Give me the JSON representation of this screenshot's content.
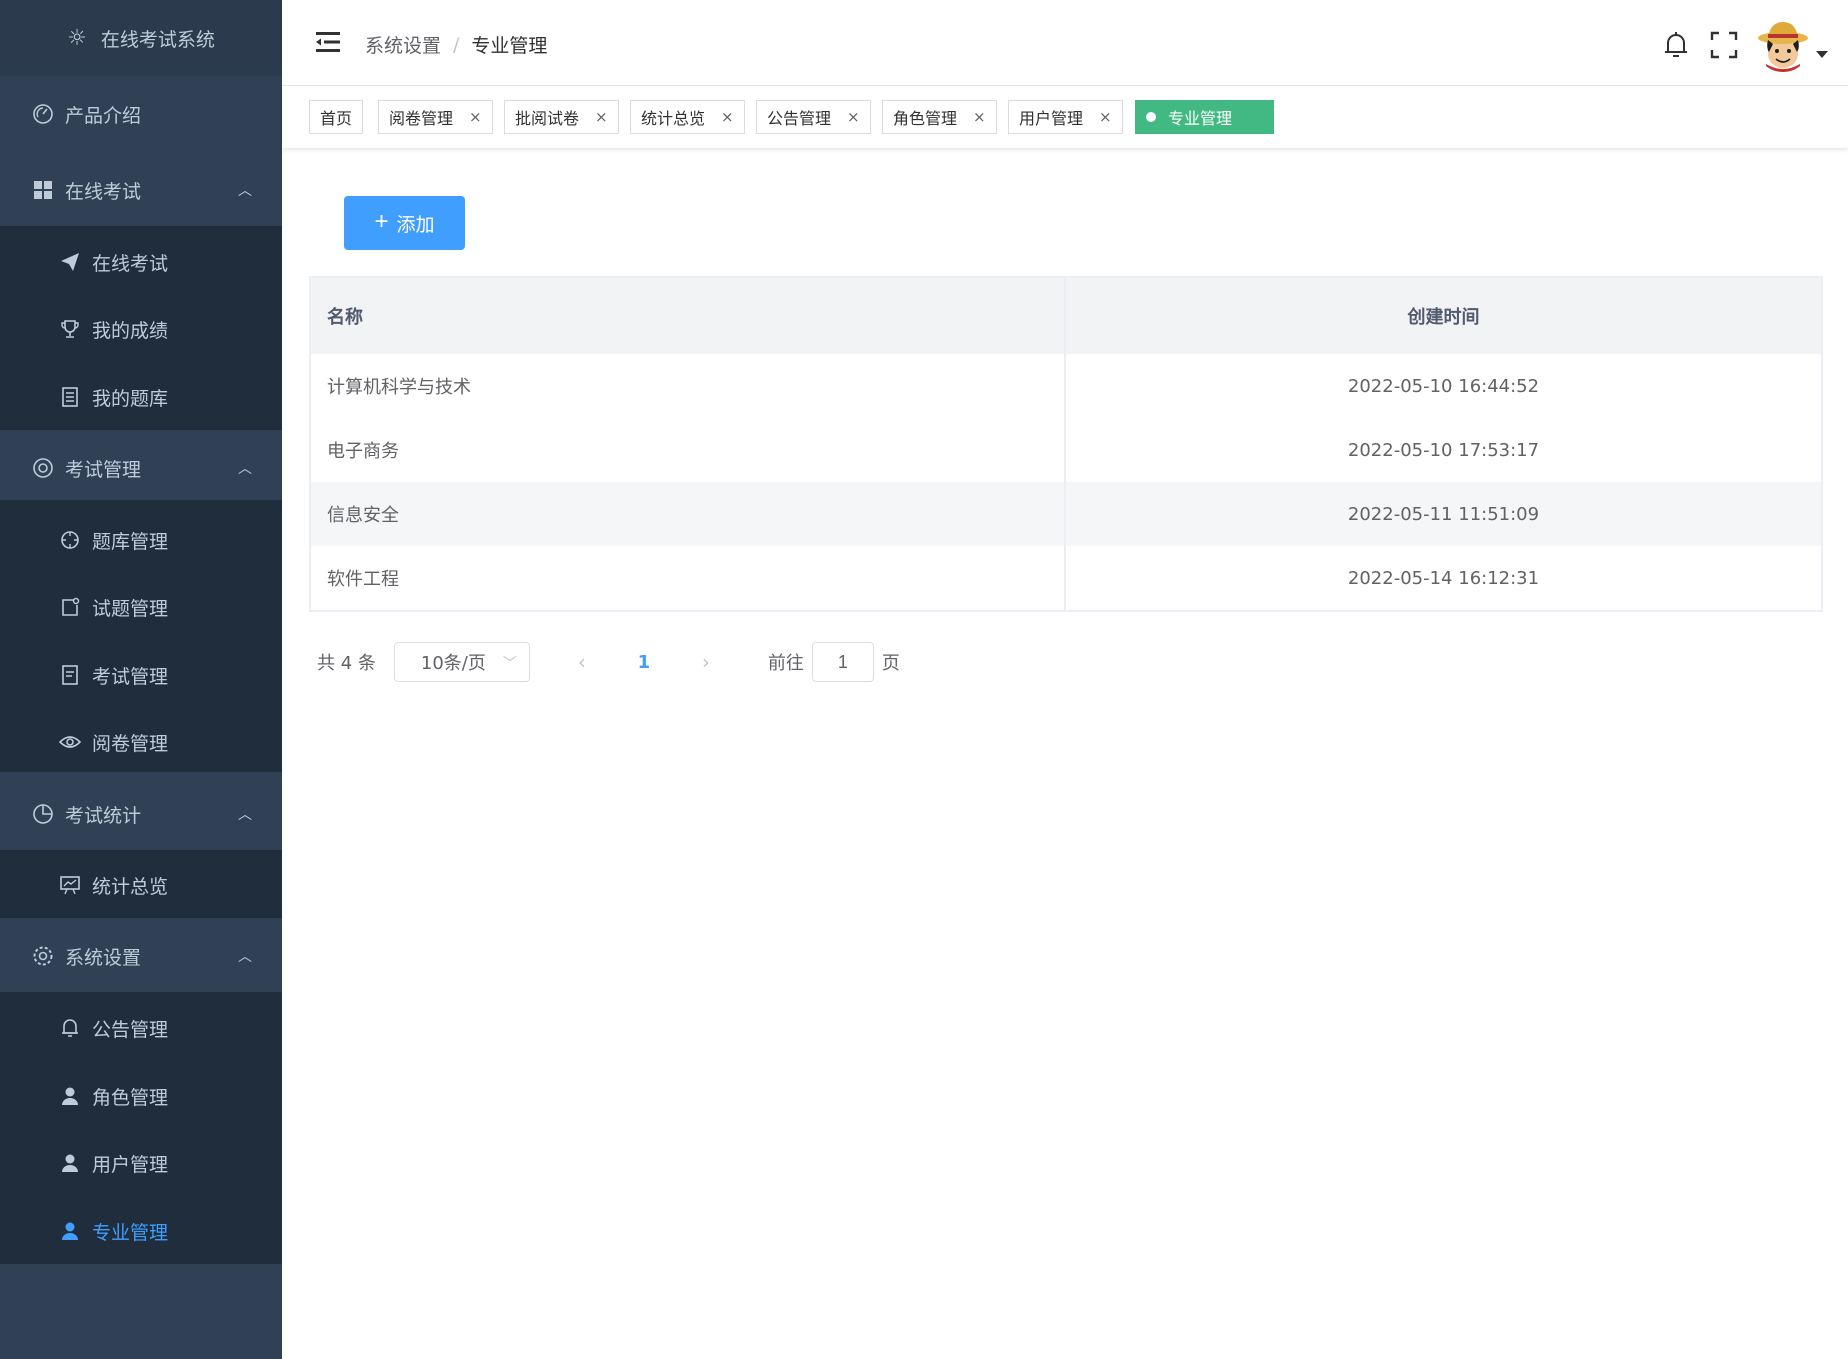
{
  "app": {
    "title": "在线考试系统"
  },
  "sidebar": {
    "items": [
      {
        "label": "产品介绍",
        "icon": "dashboard-icon"
      },
      {
        "label": "在线考试",
        "icon": "grid-icon",
        "expanded": true
      },
      {
        "label": "在线考试",
        "icon": "send-icon"
      },
      {
        "label": "我的成绩",
        "icon": "trophy-icon"
      },
      {
        "label": "我的题库",
        "icon": "book-icon"
      },
      {
        "label": "考试管理",
        "icon": "lifebuoy-icon",
        "expanded": true
      },
      {
        "label": "题库管理",
        "icon": "compass-icon"
      },
      {
        "label": "试题管理",
        "icon": "edit-icon"
      },
      {
        "label": "考试管理",
        "icon": "document-icon"
      },
      {
        "label": "阅卷管理",
        "icon": "eye-icon"
      },
      {
        "label": "考试统计",
        "icon": "pie-chart-icon",
        "expanded": true
      },
      {
        "label": "统计总览",
        "icon": "presentation-icon"
      },
      {
        "label": "系统设置",
        "icon": "gear-icon",
        "expanded": true
      },
      {
        "label": "公告管理",
        "icon": "bell-icon"
      },
      {
        "label": "角色管理",
        "icon": "user-icon"
      },
      {
        "label": "用户管理",
        "icon": "user-icon"
      },
      {
        "label": "专业管理",
        "icon": "user-icon",
        "active": true
      }
    ]
  },
  "breadcrumb": {
    "parent": "系统设置",
    "sep": "/",
    "current": "专业管理"
  },
  "tags": [
    {
      "label": "首页"
    },
    {
      "label": "阅卷管理",
      "close": "×"
    },
    {
      "label": "批阅试卷",
      "close": "×"
    },
    {
      "label": "统计总览",
      "close": "×"
    },
    {
      "label": "公告管理",
      "close": "×"
    },
    {
      "label": "角色管理",
      "close": "×"
    },
    {
      "label": "用户管理",
      "close": "×"
    },
    {
      "label": "专业管理",
      "active": true
    }
  ],
  "toolbar": {
    "add_label": "添加",
    "add_icon": "+"
  },
  "table": {
    "columns": [
      "名称",
      "创建时间"
    ],
    "rows": [
      {
        "name": "计算机科学与技术",
        "created": "2022-05-10 16:44:52"
      },
      {
        "name": "电子商务",
        "created": "2022-05-10 17:53:17"
      },
      {
        "name": "信息安全",
        "created": "2022-05-11 11:51:09"
      },
      {
        "name": "软件工程",
        "created": "2022-05-14 16:12:31"
      }
    ]
  },
  "pagination": {
    "total_text": "共 4 条",
    "page_size": "10条/页",
    "current_page": "1",
    "goto_label": "前往",
    "goto_value": "1",
    "page_suffix": "页"
  },
  "colors": {
    "sidebar_bg": "#304156",
    "accent": "#409eff",
    "active_tag": "#42b983"
  }
}
